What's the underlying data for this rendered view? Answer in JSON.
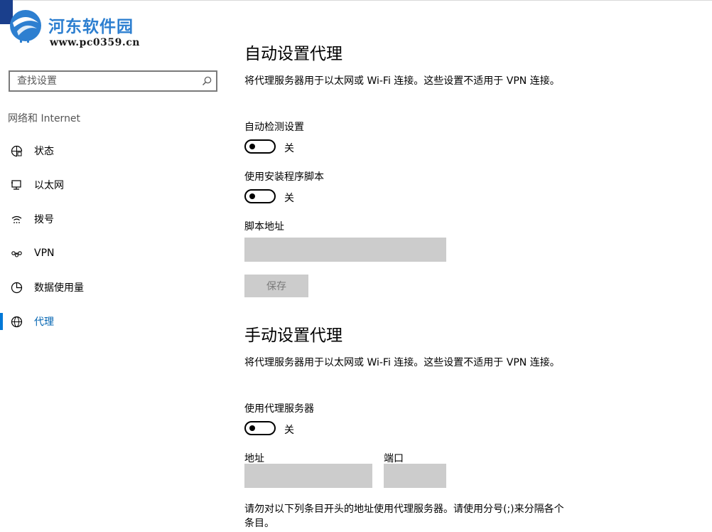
{
  "watermark": {
    "title": "河东软件园",
    "url": "www.pc0359.cn"
  },
  "sidebar": {
    "search_placeholder": "查找设置",
    "section_label": "网络和 Internet",
    "items": [
      {
        "label": "状态",
        "icon": "status-globe-icon",
        "active": false
      },
      {
        "label": "以太网",
        "icon": "ethernet-icon",
        "active": false
      },
      {
        "label": "拨号",
        "icon": "dialup-icon",
        "active": false
      },
      {
        "label": "VPN",
        "icon": "vpn-icon",
        "active": false
      },
      {
        "label": "数据使用量",
        "icon": "data-usage-icon",
        "active": false
      },
      {
        "label": "代理",
        "icon": "globe-icon",
        "active": true
      }
    ],
    "accent_color": "#0078d7"
  },
  "auto_proxy": {
    "title": "自动设置代理",
    "description": "将代理服务器用于以太网或 Wi-Fi 连接。这些设置不适用于 VPN 连接。",
    "detect_label": "自动检测设置",
    "detect_state": "关",
    "script_toggle_label": "使用安装程序脚本",
    "script_toggle_state": "关",
    "script_address_label": "脚本地址",
    "script_address_value": "",
    "save_label": "保存"
  },
  "manual_proxy": {
    "title": "手动设置代理",
    "description": "将代理服务器用于以太网或 Wi-Fi 连接。这些设置不适用于 VPN 连接。",
    "use_proxy_label": "使用代理服务器",
    "use_proxy_state": "关",
    "address_label": "地址",
    "address_value": "",
    "port_label": "端口",
    "port_value": "",
    "exceptions_note": "请勿对以下列条目开头的地址使用代理服务器。请使用分号(;)来分隔各个条目。"
  }
}
